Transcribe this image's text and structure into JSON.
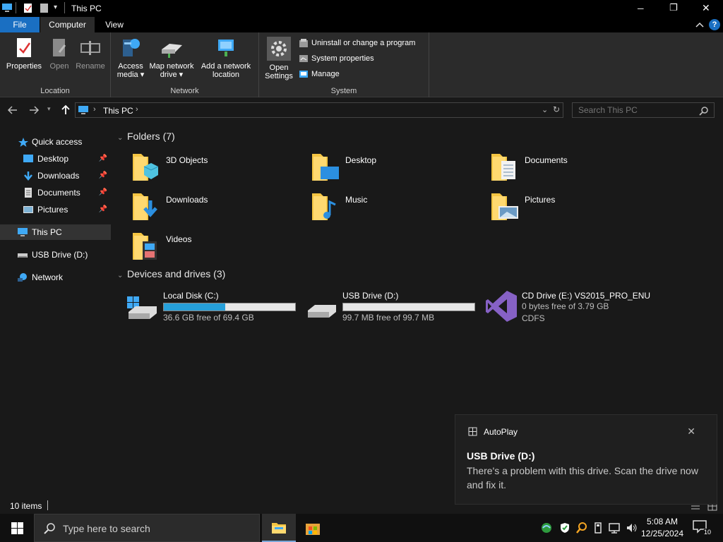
{
  "window": {
    "title": "This PC",
    "controls": {
      "minimize": "─",
      "maximize": "❐",
      "close": "✕"
    }
  },
  "ribbon": {
    "tabs": [
      "File",
      "Computer",
      "View"
    ],
    "groups": {
      "location": {
        "label": "Location",
        "buttons": [
          {
            "label": "Properties"
          },
          {
            "label": "Open"
          },
          {
            "label": "Rename"
          }
        ]
      },
      "network": {
        "label": "Network",
        "buttons": [
          {
            "line1": "Access",
            "line2": "media ▾"
          },
          {
            "line1": "Map network",
            "line2": "drive ▾"
          },
          {
            "line1": "Add a network",
            "line2": "location"
          }
        ]
      },
      "system": {
        "label": "System",
        "open_settings": {
          "line1": "Open",
          "line2": "Settings"
        },
        "items": [
          "Uninstall or change a program",
          "System properties",
          "Manage"
        ]
      }
    }
  },
  "address": {
    "path": "This PC",
    "search_placeholder": "Search This PC"
  },
  "nav_pane": {
    "quick_access": "Quick access",
    "pinned": [
      "Desktop",
      "Downloads",
      "Documents",
      "Pictures"
    ],
    "this_pc": "This PC",
    "usb": "USB Drive (D:)",
    "network": "Network"
  },
  "folders": {
    "header": "Folders (7)",
    "items": [
      "3D Objects",
      "Desktop",
      "Documents",
      "Downloads",
      "Music",
      "Pictures",
      "Videos"
    ]
  },
  "drives": {
    "header": "Devices and drives (3)",
    "items": [
      {
        "name": "Local Disk (C:)",
        "info": "36.6 GB free of 69.4 GB",
        "used_fraction": 0.47
      },
      {
        "name": "USB Drive (D:)",
        "info": "99.7 MB free of 99.7 MB",
        "used_fraction": 0.0
      },
      {
        "name": "CD Drive (E:) VS2015_PRO_ENU",
        "info": "0 bytes free of 3.79 GB",
        "fs": "CDFS"
      }
    ]
  },
  "status": {
    "items": "10 items"
  },
  "toast": {
    "app": "AutoPlay",
    "title": "USB Drive (D:)",
    "body": "There's a problem with this drive.  Scan the drive now and fix it."
  },
  "taskbar": {
    "search_placeholder": "Type here to search",
    "time": "5:08 AM",
    "date": "12/25/2024",
    "notifications": "10"
  },
  "colors": {
    "accent": "#1a6fc2",
    "drive_bar": "#26a0da",
    "folder_yellow": "#f5c542",
    "vs_purple": "#68217a"
  }
}
